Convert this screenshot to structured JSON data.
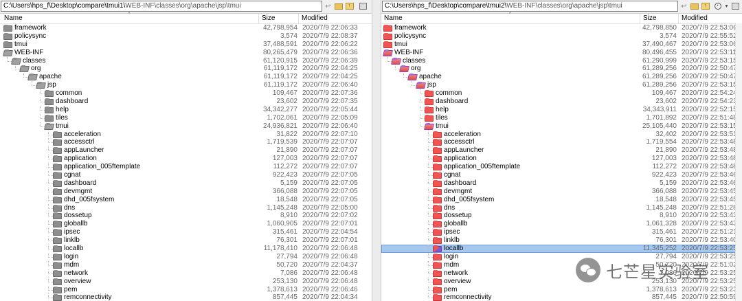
{
  "left": {
    "path_strong": "C:\\Users\\hps_f\\Desktop\\compare\\tmui1\\",
    "path_rest": "WEB-INF\\classes\\org\\apache\\jsp\\tmui",
    "col_name": "Name",
    "col_size": "Size",
    "col_modified": "Modified",
    "rows": [
      {
        "name": "framework",
        "size": "42,798,954",
        "date": "2020/7/9 22:06:33",
        "level": 0,
        "icon": "grey"
      },
      {
        "name": "policysync",
        "size": "3,574",
        "date": "2020/7/9 22:08:37",
        "level": 0,
        "icon": "grey"
      },
      {
        "name": "tmui",
        "size": "37,488,591",
        "date": "2020/7/9 22:06:22",
        "level": 0,
        "icon": "grey"
      },
      {
        "name": "WEB-INF",
        "size": "80,265,479",
        "date": "2020/7/9 22:06:36",
        "level": 0,
        "icon": "gopen"
      },
      {
        "name": "classes",
        "size": "61,120,915",
        "date": "2020/7/9 22:06:39",
        "level": 1,
        "icon": "gopen"
      },
      {
        "name": "org",
        "size": "61,119,172",
        "date": "2020/7/9 22:04:25",
        "level": 2,
        "icon": "gopen"
      },
      {
        "name": "apache",
        "size": "61,119,172",
        "date": "2020/7/9 22:04:25",
        "level": 3,
        "icon": "gopen"
      },
      {
        "name": "jsp",
        "size": "61,119,172",
        "date": "2020/7/9 22:06:40",
        "level": 4,
        "icon": "gopen"
      },
      {
        "name": "common",
        "size": "109,467",
        "date": "2020/7/9 22:07:36",
        "level": 5,
        "icon": "grey"
      },
      {
        "name": "dashboard",
        "size": "23,602",
        "date": "2020/7/9 22:07:35",
        "level": 5,
        "icon": "grey"
      },
      {
        "name": "help",
        "size": "34,342,277",
        "date": "2020/7/9 22:05:44",
        "level": 5,
        "icon": "grey"
      },
      {
        "name": "tiles",
        "size": "1,702,061",
        "date": "2020/7/9 22:05:09",
        "level": 5,
        "icon": "grey"
      },
      {
        "name": "tmui",
        "size": "24,936,821",
        "date": "2020/7/9 22:06:40",
        "level": 5,
        "icon": "gopen"
      },
      {
        "name": "acceleration",
        "size": "31,822",
        "date": "2020/7/9 22:07:10",
        "level": 6,
        "icon": "grey"
      },
      {
        "name": "accessctrl",
        "size": "1,719,539",
        "date": "2020/7/9 22:07:07",
        "level": 6,
        "icon": "grey"
      },
      {
        "name": "appLauncher",
        "size": "21,890",
        "date": "2020/7/9 22:07:07",
        "level": 6,
        "icon": "grey"
      },
      {
        "name": "application",
        "size": "127,003",
        "date": "2020/7/9 22:07:07",
        "level": 6,
        "icon": "grey"
      },
      {
        "name": "application_005ftemplate",
        "size": "112,272",
        "date": "2020/7/9 22:07:07",
        "level": 6,
        "icon": "grey"
      },
      {
        "name": "cgnat",
        "size": "922,423",
        "date": "2020/7/9 22:07:05",
        "level": 6,
        "icon": "grey"
      },
      {
        "name": "dashboard",
        "size": "5,159",
        "date": "2020/7/9 22:07:05",
        "level": 6,
        "icon": "grey"
      },
      {
        "name": "devmgmt",
        "size": "366,088",
        "date": "2020/7/9 22:07:05",
        "level": 6,
        "icon": "grey"
      },
      {
        "name": "dhd_005fsystem",
        "size": "18,548",
        "date": "2020/7/9 22:07:05",
        "level": 6,
        "icon": "grey"
      },
      {
        "name": "dns",
        "size": "1,145,248",
        "date": "2020/7/9 22:05:00",
        "level": 6,
        "icon": "grey"
      },
      {
        "name": "dossetup",
        "size": "8,910",
        "date": "2020/7/9 22:07:02",
        "level": 6,
        "icon": "grey"
      },
      {
        "name": "globallb",
        "size": "1,060,905",
        "date": "2020/7/9 22:07:01",
        "level": 6,
        "icon": "grey"
      },
      {
        "name": "ipsec",
        "size": "315,461",
        "date": "2020/7/9 22:04:54",
        "level": 6,
        "icon": "grey"
      },
      {
        "name": "linklb",
        "size": "76,301",
        "date": "2020/7/9 22:07:01",
        "level": 6,
        "icon": "grey"
      },
      {
        "name": "locallb",
        "size": "11,178,410",
        "date": "2020/7/9 22:06:48",
        "level": 6,
        "icon": "grey"
      },
      {
        "name": "login",
        "size": "27,794",
        "date": "2020/7/9 22:06:48",
        "level": 6,
        "icon": "grey"
      },
      {
        "name": "mdm",
        "size": "50,720",
        "date": "2020/7/9 22:04:37",
        "level": 6,
        "icon": "grey"
      },
      {
        "name": "network",
        "size": "7,086",
        "date": "2020/7/9 22:06:48",
        "level": 6,
        "icon": "grey"
      },
      {
        "name": "overview",
        "size": "253,130",
        "date": "2020/7/9 22:06:48",
        "level": 6,
        "icon": "grey"
      },
      {
        "name": "pem",
        "size": "1,378,613",
        "date": "2020/7/9 22:06:46",
        "level": 6,
        "icon": "grey"
      },
      {
        "name": "remconnectivity",
        "size": "857,445",
        "date": "2020/7/9 22:04:34",
        "level": 6,
        "icon": "grey"
      }
    ]
  },
  "right": {
    "path_strong": "C:\\Users\\hps_f\\Desktop\\compare\\tmui2\\",
    "path_rest": "WEB-INF\\classes\\org\\apache\\jsp\\tmui",
    "col_name": "Name",
    "col_size": "Size",
    "col_modified": "Modified",
    "rows": [
      {
        "name": "framework",
        "size": "42,798,850",
        "date": "2020/7/9 22:53:06",
        "level": 0,
        "icon": "red"
      },
      {
        "name": "policysync",
        "size": "3,574",
        "date": "2020/7/9 22:55:52",
        "level": 0,
        "icon": "red"
      },
      {
        "name": "tmui",
        "size": "37,490,467",
        "date": "2020/7/9 22:53:06",
        "level": 0,
        "icon": "red"
      },
      {
        "name": "WEB-INF",
        "size": "80,496,455",
        "date": "2020/7/9 22:53:11",
        "level": 0,
        "icon": "open"
      },
      {
        "name": "classes",
        "size": "61,290,999",
        "date": "2020/7/9 22:53:15",
        "level": 1,
        "icon": "open"
      },
      {
        "name": "org",
        "size": "61,289,256",
        "date": "2020/7/9 22:50:47",
        "level": 2,
        "icon": "open"
      },
      {
        "name": "apache",
        "size": "61,289,256",
        "date": "2020/7/9 22:50:47",
        "level": 3,
        "icon": "open"
      },
      {
        "name": "jsp",
        "size": "61,289,256",
        "date": "2020/7/9 22:53:15",
        "level": 4,
        "icon": "open"
      },
      {
        "name": "common",
        "size": "109,467",
        "date": "2020/7/9 22:54:24",
        "level": 5,
        "icon": "red"
      },
      {
        "name": "dashboard",
        "size": "23,602",
        "date": "2020/7/9 22:54:23",
        "level": 5,
        "icon": "red"
      },
      {
        "name": "help",
        "size": "34,343,911",
        "date": "2020/7/9 22:52:15",
        "level": 5,
        "icon": "red"
      },
      {
        "name": "tiles",
        "size": "1,701,892",
        "date": "2020/7/9 22:51:48",
        "level": 5,
        "icon": "red"
      },
      {
        "name": "tmui",
        "size": "25,105,440",
        "date": "2020/7/9 22:53:15",
        "level": 5,
        "icon": "open"
      },
      {
        "name": "acceleration",
        "size": "32,402",
        "date": "2020/7/9 22:53:51",
        "level": 6,
        "icon": "red"
      },
      {
        "name": "accessctrl",
        "size": "1,719,554",
        "date": "2020/7/9 22:53:48",
        "level": 6,
        "icon": "red"
      },
      {
        "name": "appLauncher",
        "size": "21,890",
        "date": "2020/7/9 22:53:48",
        "level": 6,
        "icon": "red"
      },
      {
        "name": "application",
        "size": "127,003",
        "date": "2020/7/9 22:53:48",
        "level": 6,
        "icon": "red"
      },
      {
        "name": "application_005ftemplate",
        "size": "112,272",
        "date": "2020/7/9 22:53:48",
        "level": 6,
        "icon": "red"
      },
      {
        "name": "cgnat",
        "size": "922,423",
        "date": "2020/7/9 22:53:46",
        "level": 6,
        "icon": "red"
      },
      {
        "name": "dashboard",
        "size": "5,159",
        "date": "2020/7/9 22:53:46",
        "level": 6,
        "icon": "red"
      },
      {
        "name": "devmgmt",
        "size": "366,088",
        "date": "2020/7/9 22:53:45",
        "level": 6,
        "icon": "red"
      },
      {
        "name": "dhd_005fsystem",
        "size": "18,548",
        "date": "2020/7/9 22:53:45",
        "level": 6,
        "icon": "red"
      },
      {
        "name": "dns",
        "size": "1,145,248",
        "date": "2020/7/9 22:51:28",
        "level": 6,
        "icon": "red"
      },
      {
        "name": "dossetup",
        "size": "8,910",
        "date": "2020/7/9 22:53:43",
        "level": 6,
        "icon": "red"
      },
      {
        "name": "globallb",
        "size": "1,061,328",
        "date": "2020/7/9 22:53:43",
        "level": 6,
        "icon": "red"
      },
      {
        "name": "ipsec",
        "size": "315,461",
        "date": "2020/7/9 22:51:21",
        "level": 6,
        "icon": "red"
      },
      {
        "name": "linklb",
        "size": "76,301",
        "date": "2020/7/9 22:53:40",
        "level": 6,
        "icon": "red"
      },
      {
        "name": "locallb",
        "size": "11,345,252",
        "date": "2020/7/9 22:53:25",
        "level": 6,
        "icon": "mix",
        "selected": true
      },
      {
        "name": "login",
        "size": "27,794",
        "date": "2020/7/9 22:53:25",
        "level": 6,
        "icon": "red"
      },
      {
        "name": "mdm",
        "size": "50,720",
        "date": "2020/7/9 22:51:02",
        "level": 6,
        "icon": "red"
      },
      {
        "name": "network",
        "size": "7,086",
        "date": "2020/7/9 22:53:25",
        "level": 6,
        "icon": "red"
      },
      {
        "name": "overview",
        "size": "253,130",
        "date": "2020/7/9 22:53:25",
        "level": 6,
        "icon": "red"
      },
      {
        "name": "pem",
        "size": "1,378,613",
        "date": "2020/7/9 22:53:23",
        "level": 6,
        "icon": "red"
      },
      {
        "name": "remconnectivity",
        "size": "857,445",
        "date": "2020/7/9 22:50:59",
        "level": 6,
        "icon": "red"
      }
    ]
  },
  "watermark": {
    "text": "七芒星实验室",
    "icon": "wechat-icon"
  },
  "colors": {
    "selection": "#a6c8ee",
    "folder_diff": "#ef5555",
    "folder_same": "#8d8d8d",
    "folder_newer": "#7d5ad0"
  }
}
